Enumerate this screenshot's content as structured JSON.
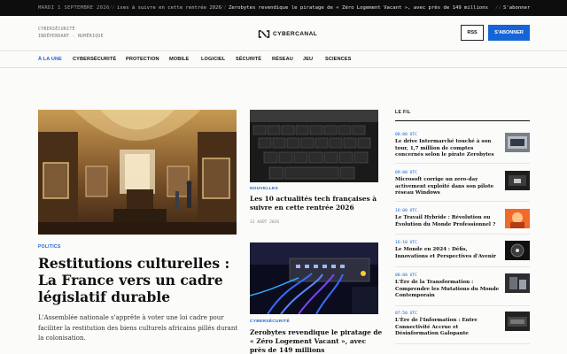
{
  "ticker": {
    "date": "MARDI 1 SEPTEMBRE 2026",
    "separator": "//",
    "item1": "ises à suivre en cette rentrée 2026",
    "item2": "Zerobytes revendique le piratage de « Zéro Logement Vacant », avec près de 149 millions",
    "item3": "S'abonner"
  },
  "masthead": {
    "tagline_line1": "CYBERSÉCURITÉ",
    "tagline_line2": "INDÉPENDANT · NUMÉRIQUE",
    "logo_text": "CYBERCANAL",
    "rss_label": "RSS",
    "subscribe_label": "S'ABONNER"
  },
  "nav": {
    "items": [
      "À LA UNE",
      "CYBERSÉCURITÉ",
      "PROTECTION",
      "MOBILE",
      "LOGICIEL",
      "SÉCURITÉ",
      "RÉSEAU",
      "JEU",
      "SCIENCES"
    ]
  },
  "hero": {
    "category": "POLITICS",
    "title": "Restitutions culturelles : La France vers un cadre législatif durable",
    "description": "L'Assemblée nationale s'apprête à voter une loi cadre pour faciliter la restitution des biens culturels africains pillés durant la colonisation."
  },
  "mid": [
    {
      "category": "NOUVELLES",
      "title": "Les 10 actualités tech françaises à suivre en cette rentrée 2026",
      "date": "31 AOÛT 2026"
    },
    {
      "category": "CYBERSÉCURITÉ",
      "title": "Zerobytes revendique le piratage de « Zéro Logement Vacant », avec près de 149 millions"
    }
  ],
  "fil": {
    "heading": "LE FIL",
    "items": [
      {
        "time": "08:00 UTC",
        "title": "Le drive Intermarché touché à son tour, 1,7 million de comptes concernés selon le pirate Zerobytes"
      },
      {
        "time": "09:00 UTC",
        "title": "Microsoft corrige un zero-day activement exploité dans son pilote réseau Windows"
      },
      {
        "time": "16:00 UTC",
        "title": "Le Travail Hybride : Révolution ou Évolution du Monde Professionnel ?"
      },
      {
        "time": "16:10 UTC",
        "title": "Le Monde en 2024 : Défis, Innovations et Perspectives d'Avenir"
      },
      {
        "time": "08:00 UTC",
        "title": "L'Ère de la Transformation : Comprendre les Mutations du Monde Contemporain"
      },
      {
        "time": "07:50 UTC",
        "title": "L'Ère de l'Information : Entre Connectivité Accrue et Désinformation Galopante"
      }
    ]
  },
  "colors": {
    "accent": "#1565d8",
    "ticker_bg": "#0d0d0d",
    "page_bg": "#fbfbfa"
  }
}
